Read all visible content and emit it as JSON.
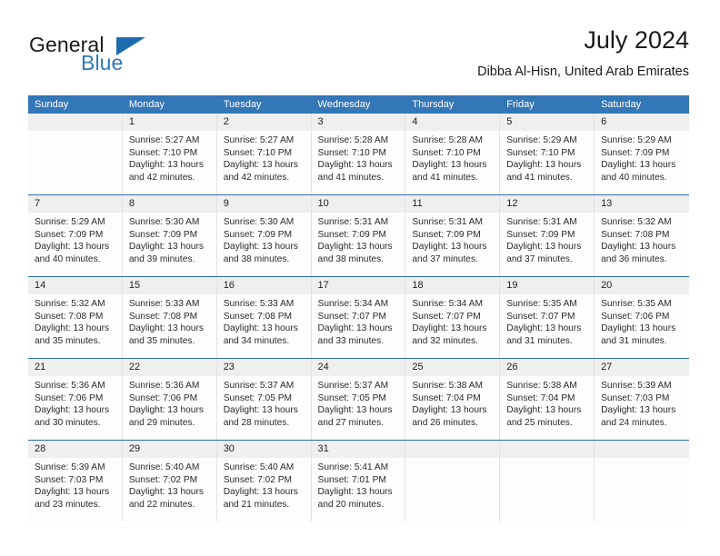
{
  "brand": {
    "name_top": "General",
    "name_bottom": "Blue",
    "triangle_icon": "triangle-icon",
    "accent_color": "#2f79bb"
  },
  "header": {
    "title": "July 2024",
    "subtitle": "Dibba Al-Hisn, United Arab Emirates"
  },
  "theme": {
    "header_row_bg": "#3477b7",
    "week_divider": "#2f6fa8",
    "daynum_band_bg": "#efefef",
    "cell_bg": "#fdfdfd",
    "text": "#222222"
  },
  "calendar": {
    "weekday_headers": [
      "Sunday",
      "Monday",
      "Tuesday",
      "Wednesday",
      "Thursday",
      "Friday",
      "Saturday"
    ],
    "weeks": [
      [
        {
          "day": "",
          "lines": []
        },
        {
          "day": "1",
          "lines": [
            "Sunrise: 5:27 AM",
            "Sunset: 7:10 PM",
            "Daylight: 13 hours",
            "and 42 minutes."
          ]
        },
        {
          "day": "2",
          "lines": [
            "Sunrise: 5:27 AM",
            "Sunset: 7:10 PM",
            "Daylight: 13 hours",
            "and 42 minutes."
          ]
        },
        {
          "day": "3",
          "lines": [
            "Sunrise: 5:28 AM",
            "Sunset: 7:10 PM",
            "Daylight: 13 hours",
            "and 41 minutes."
          ]
        },
        {
          "day": "4",
          "lines": [
            "Sunrise: 5:28 AM",
            "Sunset: 7:10 PM",
            "Daylight: 13 hours",
            "and 41 minutes."
          ]
        },
        {
          "day": "5",
          "lines": [
            "Sunrise: 5:29 AM",
            "Sunset: 7:10 PM",
            "Daylight: 13 hours",
            "and 41 minutes."
          ]
        },
        {
          "day": "6",
          "lines": [
            "Sunrise: 5:29 AM",
            "Sunset: 7:09 PM",
            "Daylight: 13 hours",
            "and 40 minutes."
          ]
        }
      ],
      [
        {
          "day": "7",
          "lines": [
            "Sunrise: 5:29 AM",
            "Sunset: 7:09 PM",
            "Daylight: 13 hours",
            "and 40 minutes."
          ]
        },
        {
          "day": "8",
          "lines": [
            "Sunrise: 5:30 AM",
            "Sunset: 7:09 PM",
            "Daylight: 13 hours",
            "and 39 minutes."
          ]
        },
        {
          "day": "9",
          "lines": [
            "Sunrise: 5:30 AM",
            "Sunset: 7:09 PM",
            "Daylight: 13 hours",
            "and 38 minutes."
          ]
        },
        {
          "day": "10",
          "lines": [
            "Sunrise: 5:31 AM",
            "Sunset: 7:09 PM",
            "Daylight: 13 hours",
            "and 38 minutes."
          ]
        },
        {
          "day": "11",
          "lines": [
            "Sunrise: 5:31 AM",
            "Sunset: 7:09 PM",
            "Daylight: 13 hours",
            "and 37 minutes."
          ]
        },
        {
          "day": "12",
          "lines": [
            "Sunrise: 5:31 AM",
            "Sunset: 7:09 PM",
            "Daylight: 13 hours",
            "and 37 minutes."
          ]
        },
        {
          "day": "13",
          "lines": [
            "Sunrise: 5:32 AM",
            "Sunset: 7:08 PM",
            "Daylight: 13 hours",
            "and 36 minutes."
          ]
        }
      ],
      [
        {
          "day": "14",
          "lines": [
            "Sunrise: 5:32 AM",
            "Sunset: 7:08 PM",
            "Daylight: 13 hours",
            "and 35 minutes."
          ]
        },
        {
          "day": "15",
          "lines": [
            "Sunrise: 5:33 AM",
            "Sunset: 7:08 PM",
            "Daylight: 13 hours",
            "and 35 minutes."
          ]
        },
        {
          "day": "16",
          "lines": [
            "Sunrise: 5:33 AM",
            "Sunset: 7:08 PM",
            "Daylight: 13 hours",
            "and 34 minutes."
          ]
        },
        {
          "day": "17",
          "lines": [
            "Sunrise: 5:34 AM",
            "Sunset: 7:07 PM",
            "Daylight: 13 hours",
            "and 33 minutes."
          ]
        },
        {
          "day": "18",
          "lines": [
            "Sunrise: 5:34 AM",
            "Sunset: 7:07 PM",
            "Daylight: 13 hours",
            "and 32 minutes."
          ]
        },
        {
          "day": "19",
          "lines": [
            "Sunrise: 5:35 AM",
            "Sunset: 7:07 PM",
            "Daylight: 13 hours",
            "and 31 minutes."
          ]
        },
        {
          "day": "20",
          "lines": [
            "Sunrise: 5:35 AM",
            "Sunset: 7:06 PM",
            "Daylight: 13 hours",
            "and 31 minutes."
          ]
        }
      ],
      [
        {
          "day": "21",
          "lines": [
            "Sunrise: 5:36 AM",
            "Sunset: 7:06 PM",
            "Daylight: 13 hours",
            "and 30 minutes."
          ]
        },
        {
          "day": "22",
          "lines": [
            "Sunrise: 5:36 AM",
            "Sunset: 7:06 PM",
            "Daylight: 13 hours",
            "and 29 minutes."
          ]
        },
        {
          "day": "23",
          "lines": [
            "Sunrise: 5:37 AM",
            "Sunset: 7:05 PM",
            "Daylight: 13 hours",
            "and 28 minutes."
          ]
        },
        {
          "day": "24",
          "lines": [
            "Sunrise: 5:37 AM",
            "Sunset: 7:05 PM",
            "Daylight: 13 hours",
            "and 27 minutes."
          ]
        },
        {
          "day": "25",
          "lines": [
            "Sunrise: 5:38 AM",
            "Sunset: 7:04 PM",
            "Daylight: 13 hours",
            "and 26 minutes."
          ]
        },
        {
          "day": "26",
          "lines": [
            "Sunrise: 5:38 AM",
            "Sunset: 7:04 PM",
            "Daylight: 13 hours",
            "and 25 minutes."
          ]
        },
        {
          "day": "27",
          "lines": [
            "Sunrise: 5:39 AM",
            "Sunset: 7:03 PM",
            "Daylight: 13 hours",
            "and 24 minutes."
          ]
        }
      ],
      [
        {
          "day": "28",
          "lines": [
            "Sunrise: 5:39 AM",
            "Sunset: 7:03 PM",
            "Daylight: 13 hours",
            "and 23 minutes."
          ]
        },
        {
          "day": "29",
          "lines": [
            "Sunrise: 5:40 AM",
            "Sunset: 7:02 PM",
            "Daylight: 13 hours",
            "and 22 minutes."
          ]
        },
        {
          "day": "30",
          "lines": [
            "Sunrise: 5:40 AM",
            "Sunset: 7:02 PM",
            "Daylight: 13 hours",
            "and 21 minutes."
          ]
        },
        {
          "day": "31",
          "lines": [
            "Sunrise: 5:41 AM",
            "Sunset: 7:01 PM",
            "Daylight: 13 hours",
            "and 20 minutes."
          ]
        },
        {
          "day": "",
          "lines": []
        },
        {
          "day": "",
          "lines": []
        },
        {
          "day": "",
          "lines": []
        }
      ]
    ]
  }
}
